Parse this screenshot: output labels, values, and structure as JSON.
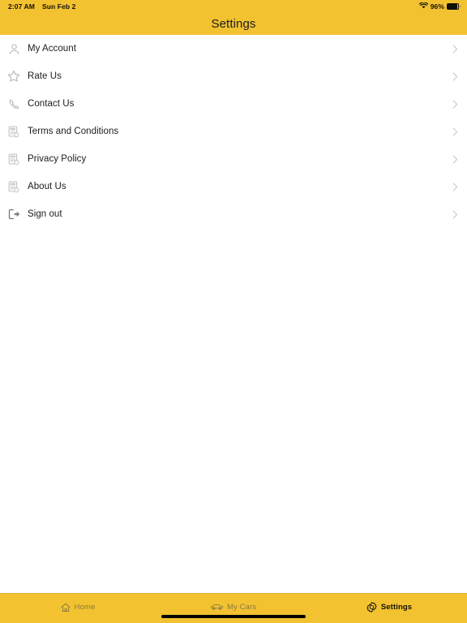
{
  "status_bar": {
    "time": "2:07 AM",
    "date": "Sun Feb 2",
    "battery_percent": "96%",
    "wifi_icon": "wifi-icon",
    "battery_icon": "battery-full-icon"
  },
  "header": {
    "title": "Settings",
    "background_color": "#F2C230"
  },
  "settings_list": {
    "items": [
      {
        "label": "My Account",
        "icon": "user-icon",
        "chevron": "chevron-right-icon"
      },
      {
        "label": "Rate Us",
        "icon": "star-icon",
        "chevron": "chevron-right-icon"
      },
      {
        "label": "Contact Us",
        "icon": "phone-icon",
        "chevron": "chevron-right-icon"
      },
      {
        "label": "Terms and Conditions",
        "icon": "document-icon",
        "chevron": "chevron-right-icon"
      },
      {
        "label": "Privacy Policy",
        "icon": "document-icon",
        "chevron": "chevron-right-icon"
      },
      {
        "label": "About Us",
        "icon": "document-icon",
        "chevron": "chevron-right-icon"
      },
      {
        "label": "Sign out",
        "icon": "sign-out-icon",
        "chevron": "chevron-right-icon"
      }
    ]
  },
  "tab_bar": {
    "background_color": "#F2C230",
    "active_color": "#141208",
    "inactive_color": "#8B7A43",
    "tabs": [
      {
        "label": "Home",
        "icon": "home-icon",
        "active": false
      },
      {
        "label": "My Cars",
        "icon": "car-icon",
        "active": false
      },
      {
        "label": "Settings",
        "icon": "gear-icon",
        "active": true
      }
    ]
  }
}
